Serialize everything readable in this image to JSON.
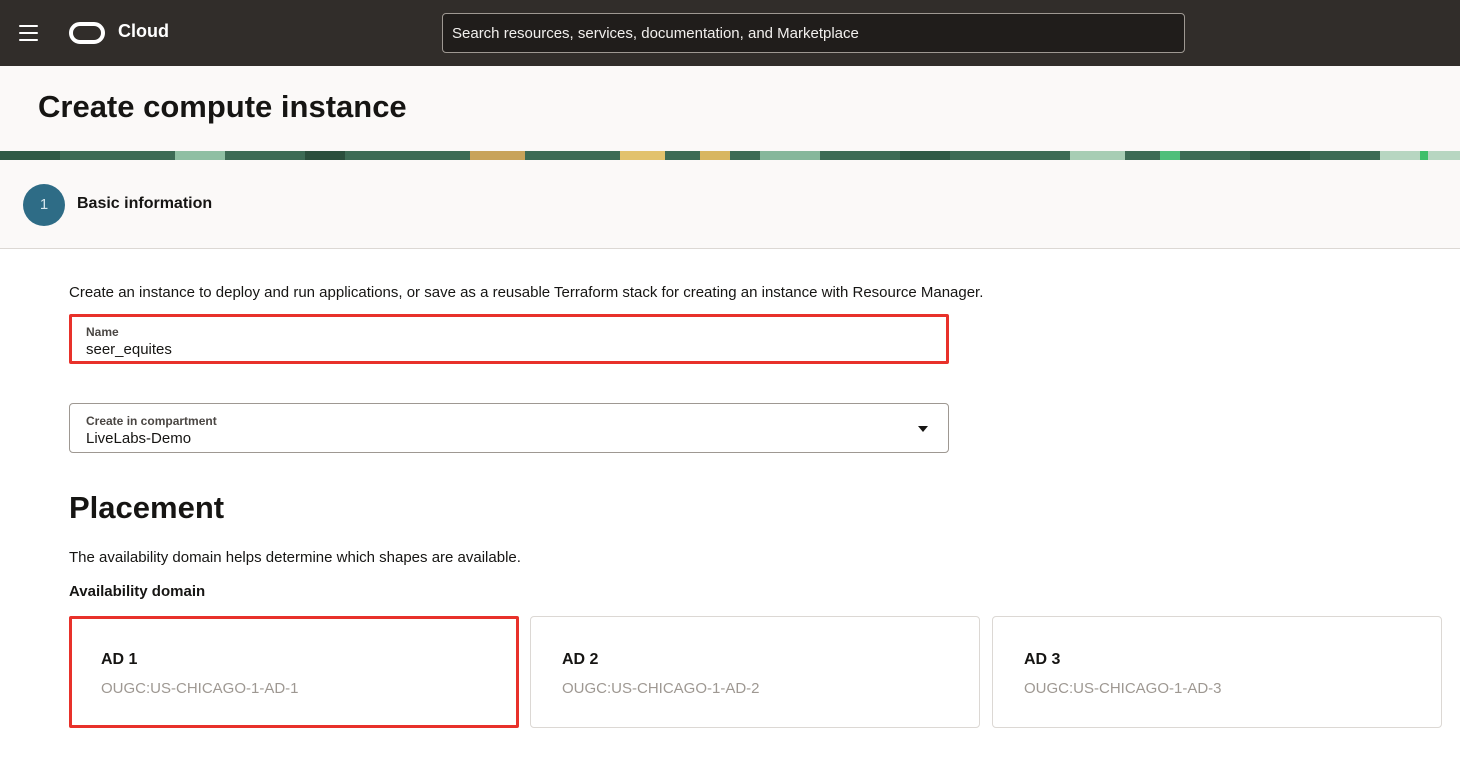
{
  "topbar": {
    "brand": "Cloud",
    "search_placeholder": "Search resources, services, documentation, and Marketplace"
  },
  "page": {
    "title": "Create compute instance"
  },
  "step": {
    "number": "1",
    "label": "Basic information"
  },
  "intro": "Create an instance to deploy and run applications, or save as a reusable Terraform stack for creating an instance with Resource Manager.",
  "name_field": {
    "label": "Name",
    "value": "seer_equites"
  },
  "compartment_field": {
    "label": "Create in compartment",
    "value": "LiveLabs-Demo"
  },
  "placement": {
    "title": "Placement",
    "description": "The availability domain helps determine which shapes are available.",
    "ad_label": "Availability domain",
    "domains": [
      {
        "name": "AD 1",
        "id": "OUGC:US-CHICAGO-1-AD-1",
        "selected": true
      },
      {
        "name": "AD 2",
        "id": "OUGC:US-CHICAGO-1-AD-2",
        "selected": false
      },
      {
        "name": "AD 3",
        "id": "OUGC:US-CHICAGO-1-AD-3",
        "selected": false
      }
    ]
  },
  "colors": {
    "topbar": "#312d2a",
    "header": "#fbf9f8",
    "step_circle": "#2e6c86",
    "highlight": "#e8312a"
  },
  "icons": [
    "hamburger-menu-icon",
    "oracle-logo-icon",
    "chevron-down-icon"
  ]
}
